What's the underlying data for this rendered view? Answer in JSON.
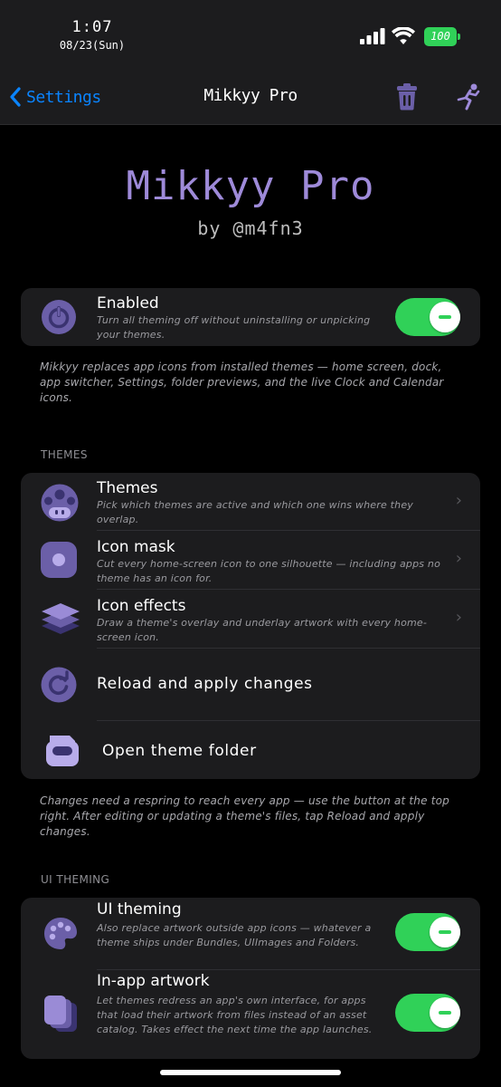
{
  "status": {
    "time": "1:07",
    "date": "08/23(Sun)",
    "battery": "100"
  },
  "nav": {
    "back_label": "Settings",
    "title": "Mikkyy Pro"
  },
  "header": {
    "title": "Mikkyy Pro",
    "byline": "by @m4fn3"
  },
  "enabled": {
    "title": "Enabled",
    "description": "Turn all theming off without uninstalling or unpicking your themes.",
    "on": true
  },
  "intro_footer": "Mikkyy replaces app icons from installed themes — home screen, dock, app switcher, Settings, folder previews, and the live Clock and Calendar icons.",
  "themes_section": {
    "header": "THEMES",
    "rows": [
      {
        "title": "Themes",
        "description": "Pick which themes are active and which one wins where they overlap."
      },
      {
        "title": "Icon mask",
        "description": "Cut every home-screen icon to one silhouette — including apps no theme has an icon for."
      },
      {
        "title": "Icon effects",
        "description": "Draw a theme's overlay and underlay artwork with every home-screen icon."
      }
    ],
    "reload_label": "Reload and apply changes",
    "open_folder_label": "Open theme folder",
    "footer": "Changes need a respring to reach every app — use the button at the top right. After editing or updating a theme's files, tap Reload and apply changes."
  },
  "ui_section": {
    "header": "UI THEMING",
    "rows": [
      {
        "title": "UI theming",
        "description": "Also replace artwork outside app icons — whatever a theme ships under Bundles, UIImages and Folders.",
        "on": true
      },
      {
        "title": "In-app artwork",
        "description": "Let themes redress an app's own interface, for apps that load their artwork from files instead of an asset catalog. Takes effect the next time the app launches.",
        "on": true
      }
    ]
  },
  "colors": {
    "accent": "#9e8ad9",
    "toggle_on": "#30d158",
    "link": "#0a84ff",
    "card": "#1c1c1e"
  }
}
